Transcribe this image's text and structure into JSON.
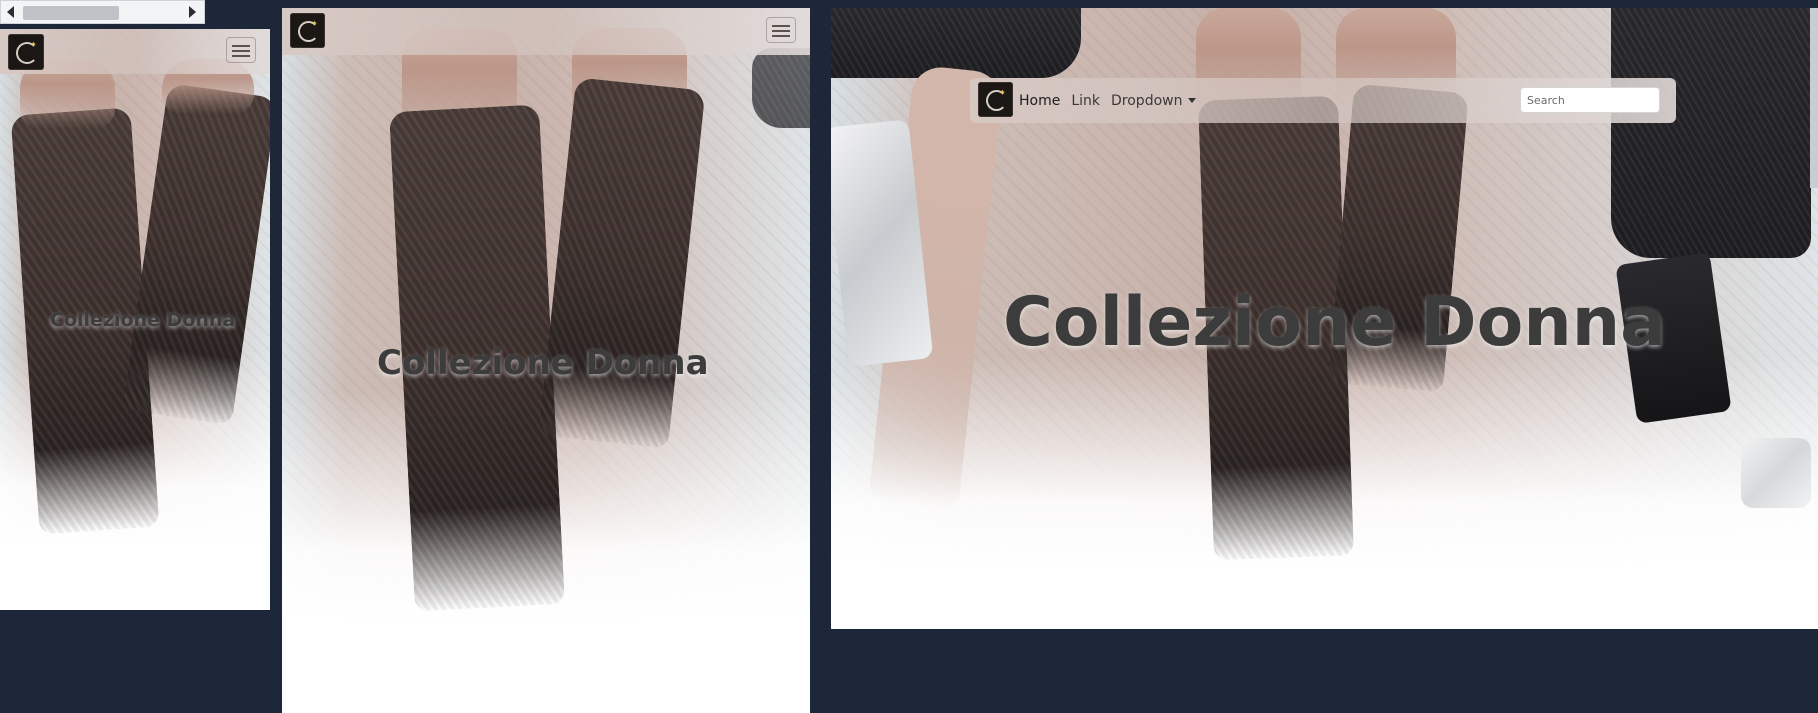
{
  "brand": "Collezione Donna",
  "nav": {
    "links": [
      "Home",
      "Link",
      "Dropdown"
    ],
    "search_placeholder": "Search"
  },
  "icons": {
    "logo": "brand-logo-icon",
    "toggler": "hamburger-menu-icon",
    "dropdown": "caret-down-icon"
  },
  "colors": {
    "page_background": "#1e2739",
    "heading": "#3c3c3c"
  }
}
